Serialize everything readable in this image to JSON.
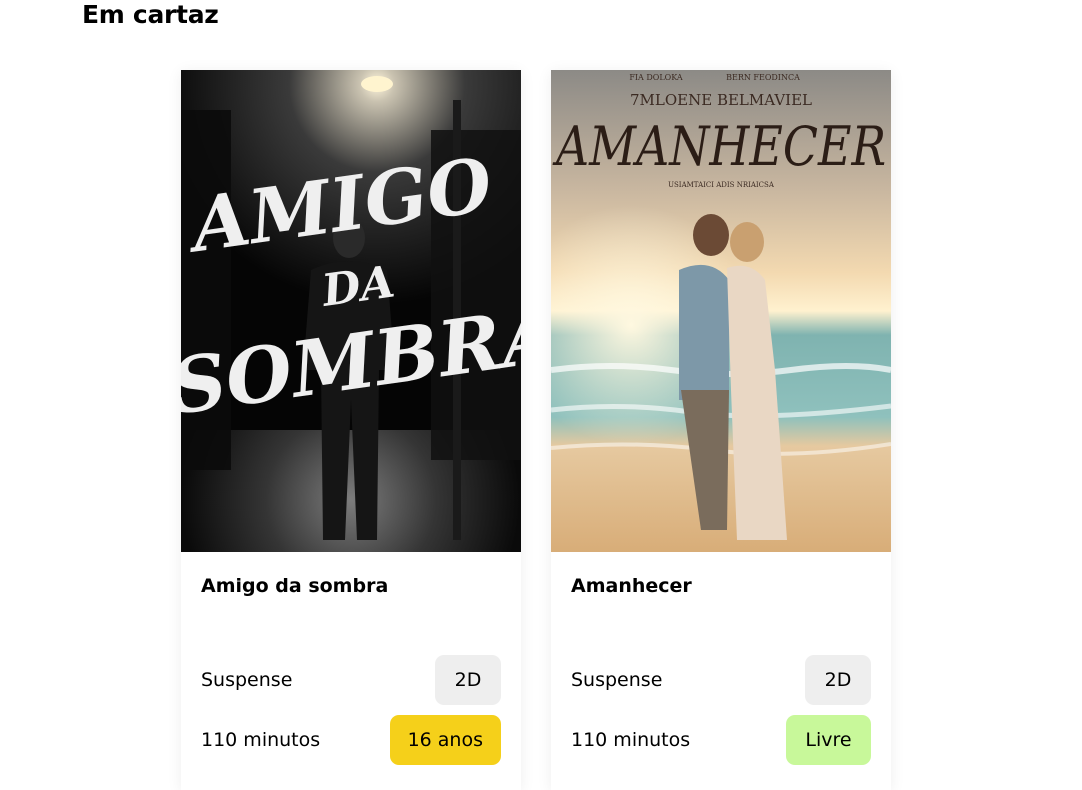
{
  "section": {
    "title": "Em cartaz"
  },
  "movies": [
    {
      "title": "Amigo da sombra",
      "poster": {
        "line1": "AMIGO",
        "line2": "DA",
        "line3": "SOMBRA"
      },
      "genre": "Suspense",
      "format": "2D",
      "duration": "110 minutos",
      "rating": "16 anos",
      "rating_color": "#f5d01a"
    },
    {
      "title": "Amanhecer",
      "poster": {
        "credit_left": "FIA DOLOKA",
        "credit_right": "BERN FEODINCA",
        "names": "7MLOENE BELMAVIEL",
        "title": "AMANHECER",
        "tagline": "USIAMTAICI ADIS NRIAICSA"
      },
      "genre": "Suspense",
      "format": "2D",
      "duration": "110 minutos",
      "rating": "Livre",
      "rating_color": "#c8f89a"
    }
  ]
}
